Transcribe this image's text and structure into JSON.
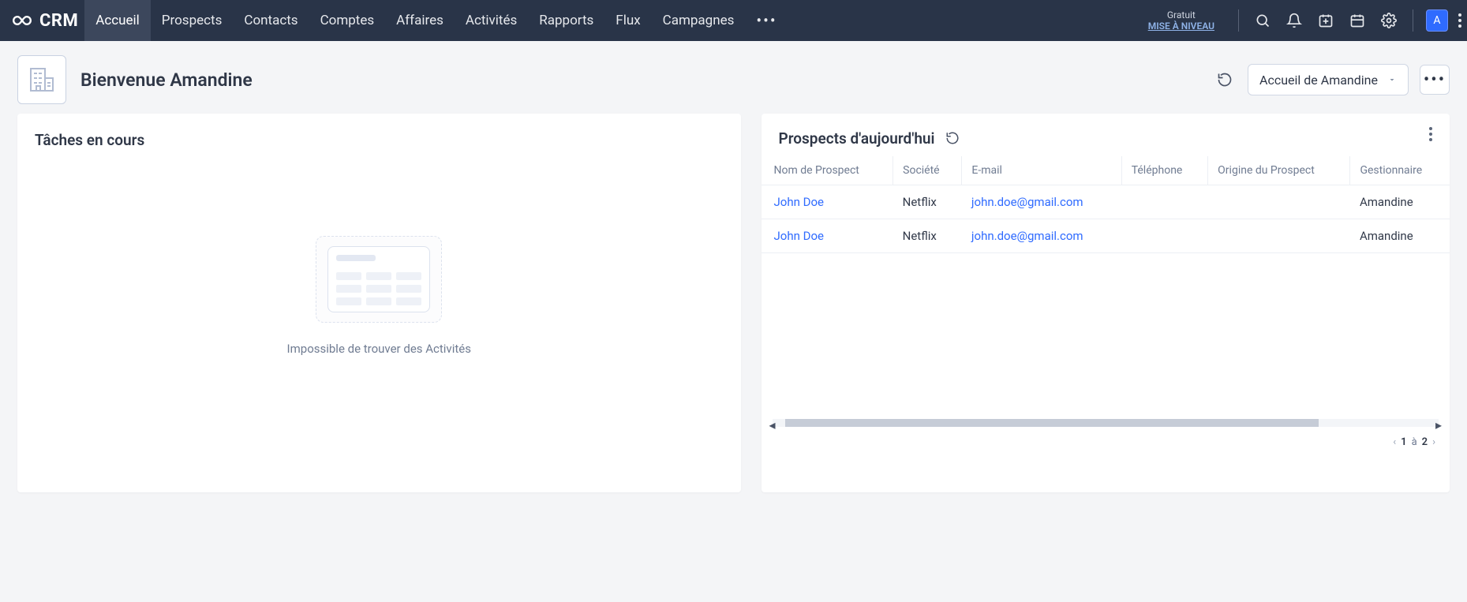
{
  "brand": "CRM",
  "nav": {
    "items": [
      "Accueil",
      "Prospects",
      "Contacts",
      "Comptes",
      "Affaires",
      "Activités",
      "Rapports",
      "Flux",
      "Campagnes"
    ],
    "active_index": 0
  },
  "upgrade": {
    "top": "Gratuit",
    "cta": "MISE À NIVEAU"
  },
  "avatar_initial": "A",
  "welcome": "Bienvenue Amandine",
  "view_selector_label": "Accueil de Amandine",
  "left_panel_title": "Tâches en cours",
  "left_panel_empty_msg": "Impossible de trouver des Activités",
  "right_panel_title": "Prospects d'aujourd'hui",
  "table": {
    "columns": [
      "Nom de Prospect",
      "Société",
      "E-mail",
      "Téléphone",
      "Origine du Prospect",
      "Gestionnaire"
    ],
    "rows": [
      {
        "nom": "John Doe",
        "societe": "Netflix",
        "email": "john.doe@gmail.com",
        "tel": "",
        "origine": "",
        "gestionnaire": "Amandine"
      },
      {
        "nom": "John Doe",
        "societe": "Netflix",
        "email": "john.doe@gmail.com",
        "tel": "",
        "origine": "",
        "gestionnaire": "Amandine"
      }
    ]
  },
  "pager": {
    "current": "1",
    "sep": "à",
    "total": "2"
  }
}
